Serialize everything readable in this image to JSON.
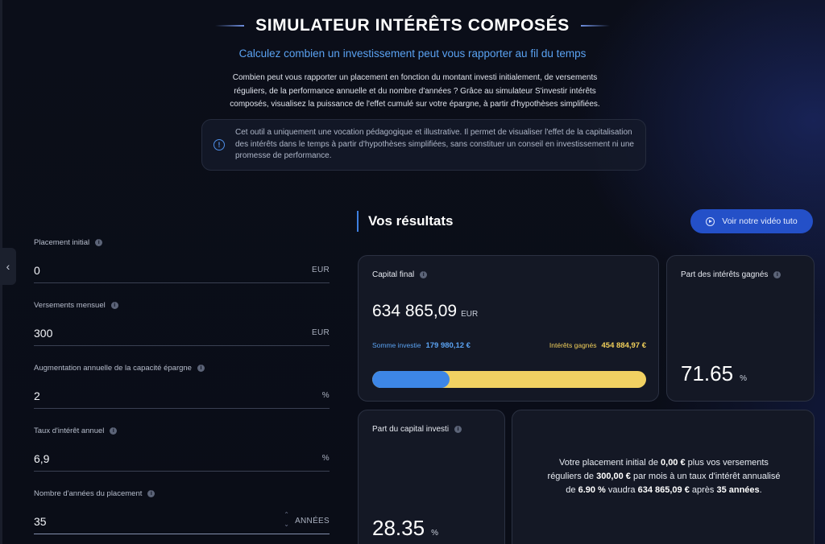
{
  "header": {
    "title": "SIMULATEUR INTÉRÊTS COMPOSÉS",
    "subtitle": "Calculez combien un investissement peut vous rapporter au fil du temps",
    "description": "Combien peut vous rapporter un placement en fonction du montant investi initialement, de versements réguliers, de la performance annuelle et du nombre d'années ? Grâce au simulateur S'investir intérêts composés, visualisez la puissance de l'effet cumulé sur votre épargne, à partir d'hypothèses simplifiées.",
    "notice": "Cet outil a uniquement une vocation pédagogique et illustrative. Il permet de visualiser l'effet de la capitalisation des intérêts dans le temps à partir d'hypothèses simplifiées, sans constituer un conseil en investissement ni une promesse de performance."
  },
  "sidebar": {
    "collapse_glyph": "‹"
  },
  "form": {
    "fields": [
      {
        "label": "Placement initial",
        "value": "0",
        "unit": "EUR"
      },
      {
        "label": "Versements mensuel",
        "value": "300",
        "unit": "EUR"
      },
      {
        "label": "Augmentation annuelle de la capacité épargne",
        "value": "2",
        "unit": "%"
      },
      {
        "label": "Taux d'intérêt annuel",
        "value": "6,9",
        "unit": "%"
      },
      {
        "label": "Nombre d'années du placement",
        "value": "35",
        "unit": "ANNÉES"
      }
    ],
    "info_glyph": "i",
    "stepper_up": "⌃",
    "stepper_down": "⌄"
  },
  "results": {
    "title": "Vos résultats",
    "video_button": "Voir notre vidéo tuto",
    "capital_final": {
      "label": "Capital final",
      "value": "634 865,09",
      "unit": "EUR",
      "invested_label": "Somme investie",
      "invested_value": "179 980,12 €",
      "interest_label": "Intérêts gagnés",
      "interest_value": "454 884,97 €",
      "invested_fraction": 0.2835
    },
    "interest_share": {
      "label": "Part des intérêts gagnés",
      "value": "71.65",
      "unit": "%"
    },
    "capital_share": {
      "label": "Part du capital investi",
      "value": "28.35",
      "unit": "%"
    },
    "summary": {
      "t1": "Votre placement initial de ",
      "v1": "0,00 €",
      "t2": " plus vos versements réguliers de ",
      "v2": "300,00 €",
      "t3": " par mois à un taux d'intérêt annualisé de ",
      "v3": "6.90 %",
      "t4": " vaudra ",
      "v4": "634 865,09 €",
      "t5": " après ",
      "v5": "35 années",
      "t6": "."
    }
  },
  "colors": {
    "accent": "#2450c8",
    "invested": "#3d86e6",
    "interest": "#f1d162",
    "subtitle": "#5aa2f2"
  }
}
